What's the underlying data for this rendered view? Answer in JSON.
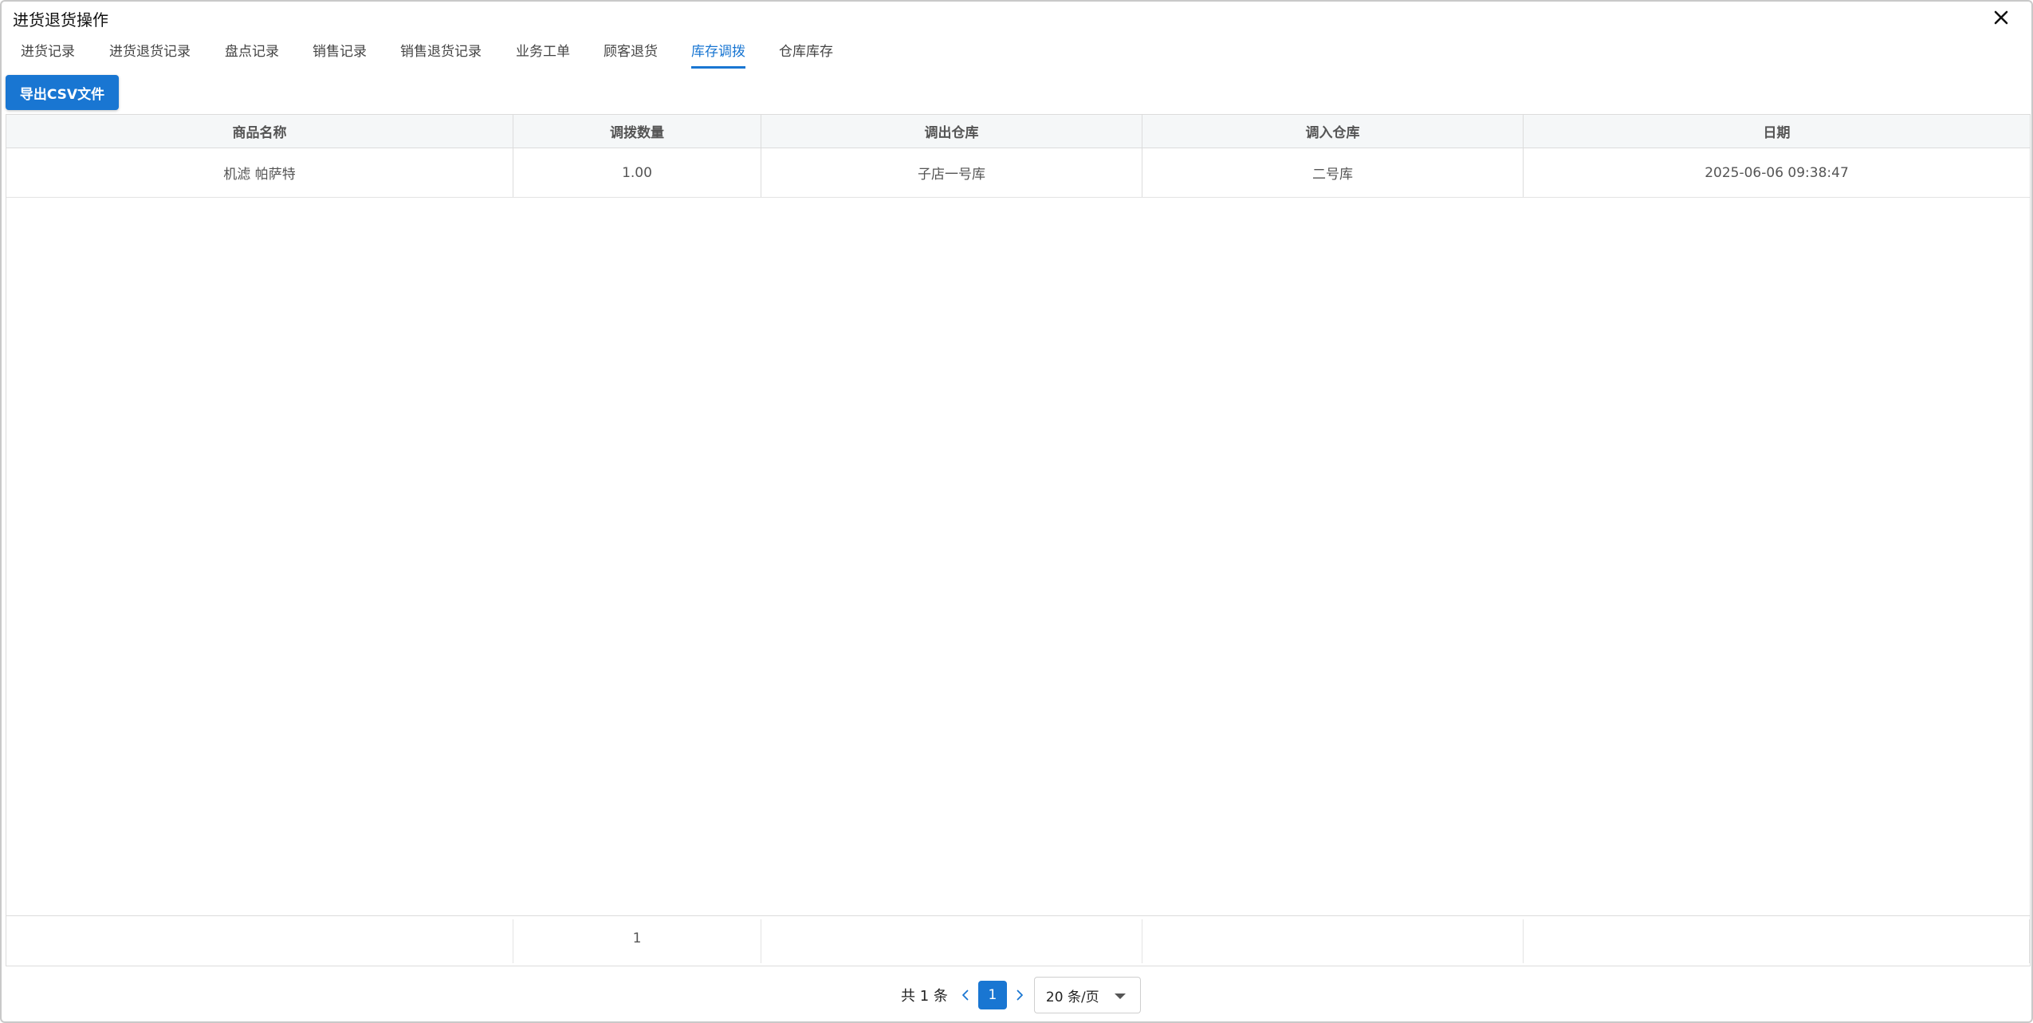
{
  "dialog": {
    "title": "进货退货操作"
  },
  "tabs": [
    {
      "label": "进货记录",
      "active": false
    },
    {
      "label": "进货退货记录",
      "active": false
    },
    {
      "label": "盘点记录",
      "active": false
    },
    {
      "label": "销售记录",
      "active": false
    },
    {
      "label": "销售退货记录",
      "active": false
    },
    {
      "label": "业务工单",
      "active": false
    },
    {
      "label": "顾客退货",
      "active": false
    },
    {
      "label": "库存调拨",
      "active": true
    },
    {
      "label": "仓库库存",
      "active": false
    }
  ],
  "toolbar": {
    "export_label": "导出CSV文件"
  },
  "table": {
    "columns": [
      "商品名称",
      "调拨数量",
      "调出仓库",
      "调入仓库",
      "日期"
    ],
    "rows": [
      [
        "机滤 帕萨特",
        "1.00",
        "子店一号库",
        "二号库",
        "2025-06-06 09:38:47"
      ]
    ],
    "footer": [
      "",
      "1",
      "",
      "",
      ""
    ]
  },
  "pagination": {
    "total_text": "共 1 条",
    "current_page": "1",
    "page_size": "20 条/页"
  },
  "colors": {
    "accent": "#1976d2"
  }
}
